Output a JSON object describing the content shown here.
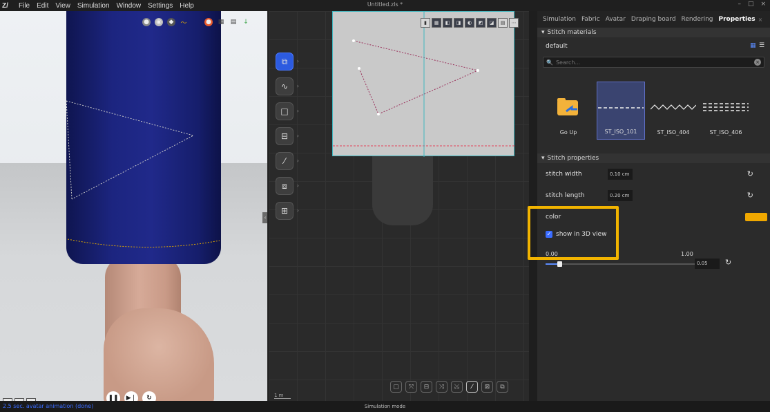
{
  "menubar": {
    "logo": "Z/",
    "items": [
      "File",
      "Edit",
      "View",
      "Simulation",
      "Window",
      "Settings",
      "Help"
    ],
    "window_title": "Untitled.zls *",
    "minimize": "–",
    "maximize": "□",
    "close": "×"
  },
  "view3d": {
    "playback": {
      "pause": "❚❚",
      "step": "▶❘",
      "reset": "↻"
    }
  },
  "pattern2d": {
    "scale_label": "1 m",
    "tool_arrow": "›"
  },
  "right_panel": {
    "tabs": [
      "Simulation",
      "Fabric",
      "Avatar",
      "Draping board",
      "Rendering",
      "Properties"
    ],
    "active_tab": "Properties",
    "tab_close": "×",
    "stitch_materials_title": "Stitch materials",
    "collapse_glyph": "▾",
    "material_group": "default",
    "search_placeholder": "Search...",
    "search_icon": "🔍",
    "clear_icon": "×",
    "materials": [
      {
        "label": "Go Up"
      },
      {
        "label": "ST_ISO_101"
      },
      {
        "label": "ST_ISO_404"
      },
      {
        "label": "ST_ISO_406"
      }
    ],
    "stitch_properties_title": "Stitch properties",
    "stitch_width_label": "stitch width",
    "stitch_width_value": "0.10 cm",
    "stitch_length_label": "stitch length",
    "stitch_length_value": "0.20 cm",
    "color_label": "color",
    "color_value": "#f0a800",
    "show_3d_label": "show in 3D view",
    "show_3d_checked": true,
    "slider_min": "0.00",
    "slider_max": "1.00",
    "slider_value": "0.05",
    "slider_fraction": 0.05,
    "reset_glyph": "↻",
    "check_glyph": "✓"
  },
  "statusbar": {
    "left": "2.5 sec. avatar animation (done)",
    "center": "Simulation mode"
  },
  "colors": {
    "accent": "#2c5be0",
    "highlight": "#f2b400",
    "stitch_color": "#f0a800"
  }
}
